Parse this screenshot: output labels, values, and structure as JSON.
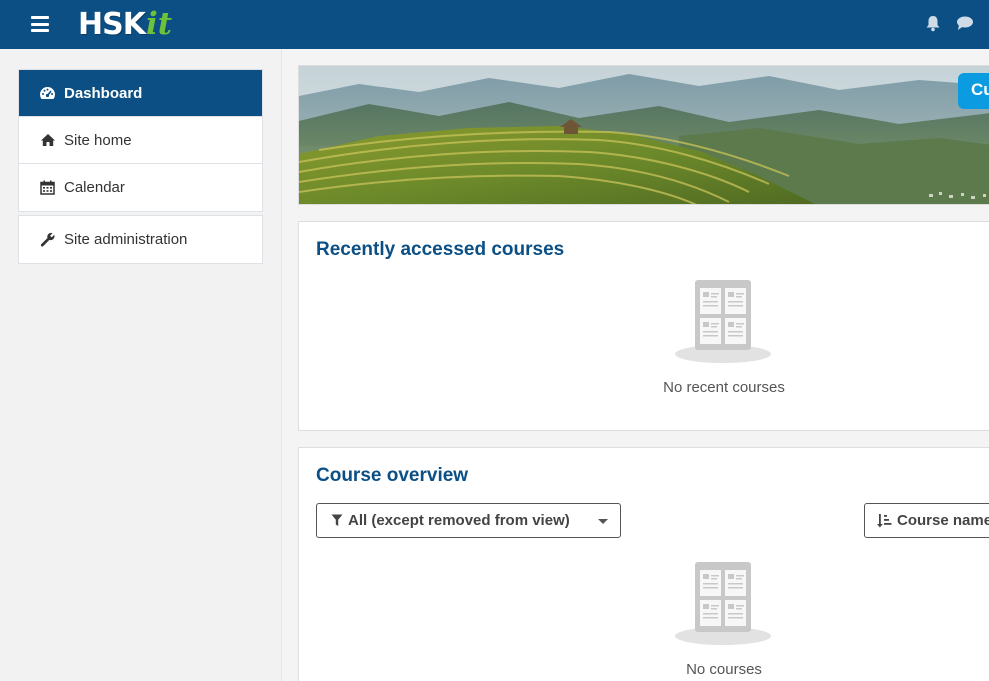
{
  "navbar": {
    "logo_main": "HSK",
    "logo_accent": "it",
    "icons": [
      "menu-icon",
      "bell-icon",
      "chat-icon"
    ],
    "colors": {
      "background": "#0b4f84",
      "logo_accent": "#6ec23a"
    }
  },
  "sidebar": {
    "items": [
      {
        "label": "Dashboard",
        "icon": "dashboard-icon",
        "active": true
      },
      {
        "label": "Site home",
        "icon": "home-icon"
      },
      {
        "label": "Calendar",
        "icon": "calendar-icon"
      }
    ],
    "admin": {
      "label": "Site administration",
      "icon": "wrench-icon"
    }
  },
  "banner": {
    "customise_label": "Customise this page"
  },
  "recent": {
    "title": "Recently accessed courses",
    "empty_text": "No recent courses"
  },
  "overview": {
    "title": "Course overview",
    "filter_label": "All (except removed from view)",
    "sort_label": "Course name",
    "empty_text": "No courses"
  },
  "colors": {
    "accent": "#0b4f84",
    "button": "#0b9be0"
  }
}
